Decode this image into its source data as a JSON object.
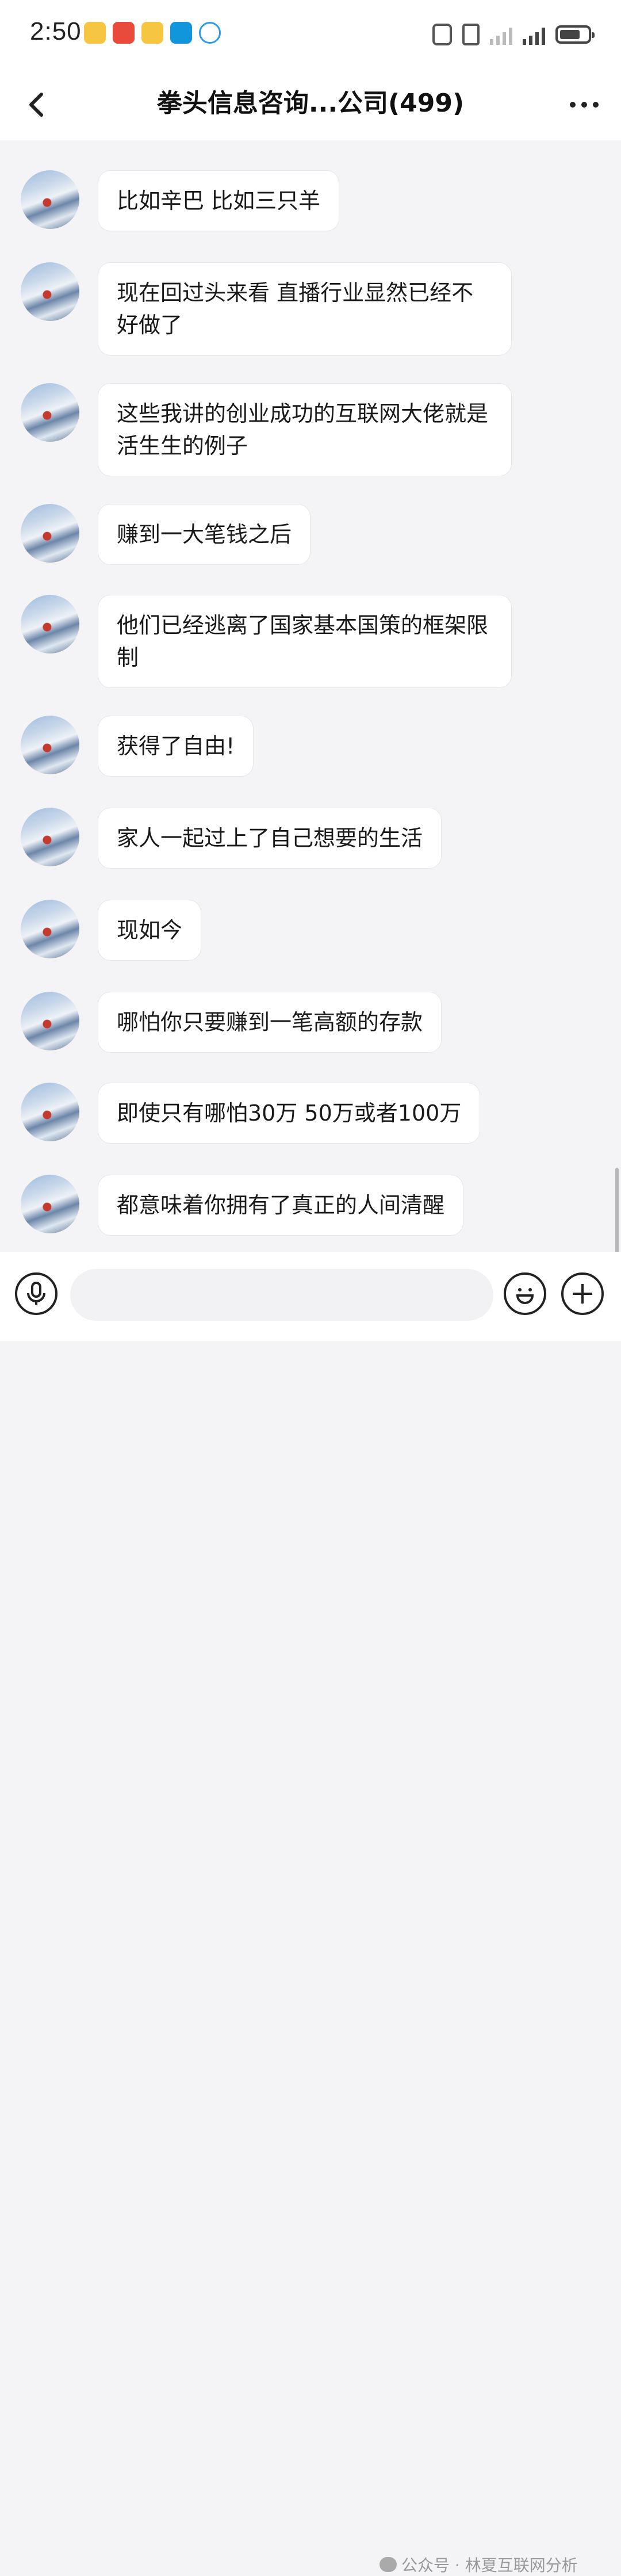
{
  "status_bar": {
    "time": "2:50",
    "app_icons": [
      "weibo-icon",
      "app-red-icon",
      "weibo-icon",
      "search-app-icon",
      "app-swirl-icon"
    ],
    "system_icons": [
      "nfc-icon",
      "vibrate-icon",
      "signal-icon",
      "signal-icon",
      "battery-icon"
    ]
  },
  "header": {
    "title": "拳头信息咨询...公司(499)",
    "back_icon": "chevron-left-icon",
    "more_icon": "more-dots-icon"
  },
  "messages": [
    {
      "text": "比如辛巴 比如三只羊"
    },
    {
      "text": "现在回过头来看  直播行业显然已经不好做了"
    },
    {
      "text": "这些我讲的创业成功的互联网大佬就是活生生的例子"
    },
    {
      "text": "赚到一大笔钱之后"
    },
    {
      "text": "他们已经逃离了国家基本国策的框架限制"
    },
    {
      "text": "获得了自由!"
    },
    {
      "text": "家人一起过上了自己想要的生活"
    },
    {
      "text": "现如今"
    },
    {
      "text": "哪怕你只要赚到一笔高额的存款"
    },
    {
      "text": "即使只有哪怕30万 50万或者100万"
    },
    {
      "text": "都意味着你拥有了真正的人间清醒"
    }
  ],
  "input_bar": {
    "placeholder": "",
    "voice_icon": "microphone-icon",
    "emoji_icon": "emoji-icon",
    "add_icon": "plus-icon"
  },
  "watermark": {
    "text": "公众号 · 林夏互联网分析"
  }
}
